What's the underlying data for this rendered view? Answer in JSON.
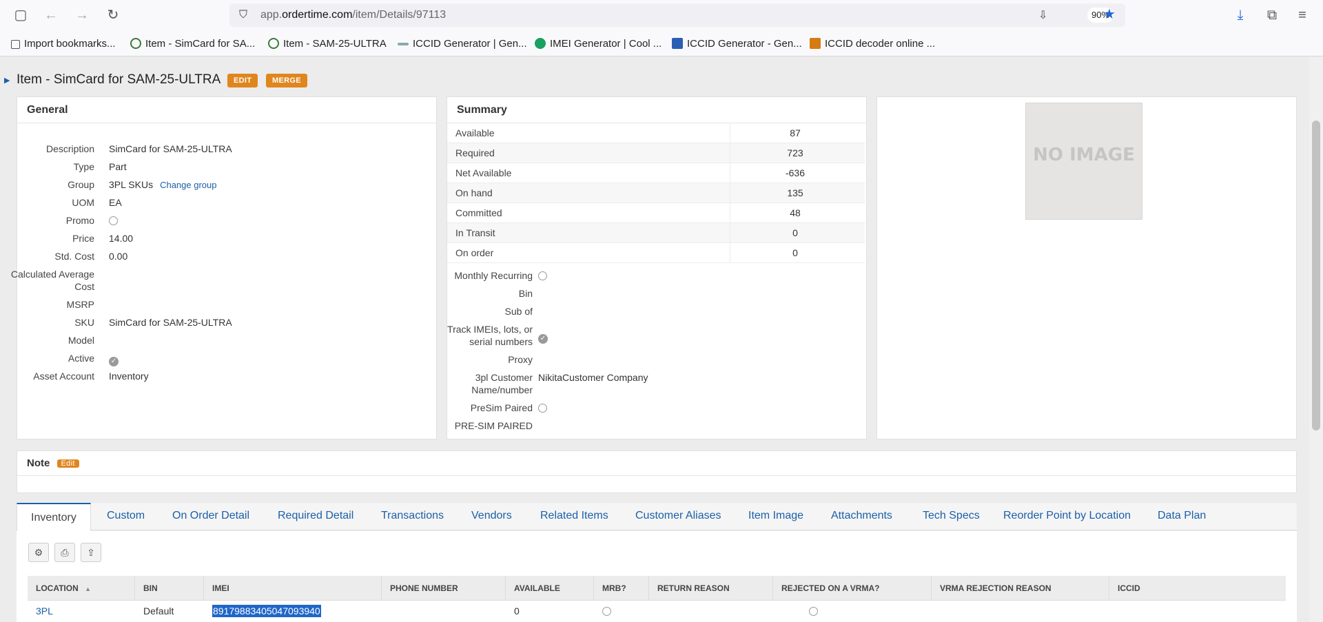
{
  "browser": {
    "url_prefix": "app.",
    "url_domain": "ordertime.com",
    "url_path": "/item/Details/97113",
    "zoom": "90%",
    "bookmarks": [
      "Import bookmarks...",
      "Item - SimCard for SA...",
      "Item - SAM-25-ULTRA",
      "ICCID Generator | Gen...",
      "IMEI Generator | Cool ...",
      "ICCID Generator - Gen...",
      "ICCID decoder online ..."
    ]
  },
  "header": {
    "title": "Item - SimCard for SAM-25-ULTRA",
    "edit_label": "EDIT",
    "merge_label": "MERGE"
  },
  "general": {
    "title": "General",
    "fields": [
      {
        "label": "Description",
        "value": "SimCard for SAM-25-ULTRA"
      },
      {
        "label": "Type",
        "value": "Part"
      },
      {
        "label": "Group",
        "value": "3PL SKUs",
        "link": "Change group"
      },
      {
        "label": "UOM",
        "value": "EA"
      },
      {
        "label": "Promo",
        "value": ""
      },
      {
        "label": "Price",
        "value": "14.00"
      },
      {
        "label": "Std. Cost",
        "value": "0.00"
      },
      {
        "label": "Calculated Average",
        "label2": "Cost",
        "value": ""
      },
      {
        "label": "MSRP",
        "value": ""
      },
      {
        "label": "SKU",
        "value": "SimCard for SAM-25-ULTRA"
      },
      {
        "label": "Model",
        "value": ""
      },
      {
        "label": "Active",
        "value": ""
      },
      {
        "label": "Asset Account",
        "value": "Inventory"
      }
    ]
  },
  "summary": {
    "title": "Summary",
    "rows": [
      {
        "label": "Available",
        "value": "87"
      },
      {
        "label": "Required",
        "value": "723"
      },
      {
        "label": "Net Available",
        "value": "-636"
      },
      {
        "label": "On hand",
        "value": "135"
      },
      {
        "label": "Committed",
        "value": "48"
      },
      {
        "label": "In Transit",
        "value": "0"
      },
      {
        "label": "On order",
        "value": "0"
      }
    ],
    "fields": [
      {
        "label": "Monthly Recurring",
        "value": ""
      },
      {
        "label": "Bin",
        "value": ""
      },
      {
        "label": "Sub of",
        "value": ""
      },
      {
        "label": "Track IMEIs, lots, or",
        "label2": "serial numbers",
        "value": ""
      },
      {
        "label": "Proxy",
        "value": ""
      },
      {
        "label": "3pl Customer",
        "label2": "Name/number",
        "value": "NikitaCustomer Company"
      },
      {
        "label": "PreSim Paired",
        "value": ""
      },
      {
        "label": "PRE-SIM PAIRED",
        "value": ""
      }
    ]
  },
  "image": {
    "placeholder": "NO IMAGE"
  },
  "note": {
    "title": "Note",
    "edit_label": "Edit"
  },
  "tabs": [
    "Inventory",
    "Custom",
    "On Order Detail",
    "Required Detail",
    "Transactions",
    "Vendors",
    "Related Items",
    "Customer Aliases",
    "Item Image",
    "Attachments",
    "Tech Specs",
    "Reorder Point by Location",
    "Data Plan"
  ],
  "grid": {
    "columns": [
      "LOCATION",
      "BIN",
      "IMEI",
      "PHONE NUMBER",
      "AVAILABLE",
      "MRB?",
      "RETURN REASON",
      "REJECTED ON A VRMA?",
      "VRMA REJECTION REASON",
      "ICCID"
    ],
    "rows": [
      {
        "location": "3PL",
        "bin": "Default",
        "imei": "89179883405047093940",
        "phone": "",
        "available": "0"
      }
    ]
  }
}
